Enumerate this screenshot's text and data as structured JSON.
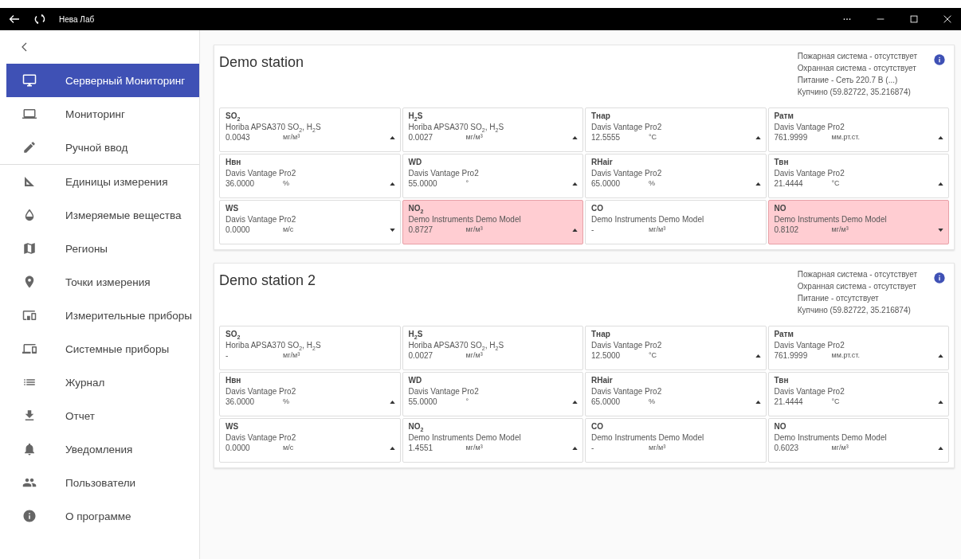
{
  "window": {
    "title": "Нева Лаб"
  },
  "sidebar": {
    "sections": [
      [
        {
          "label": "Серверный Мониторинг",
          "selected": true
        },
        {
          "label": "Мониторинг",
          "selected": false
        },
        {
          "label": "Ручной ввод",
          "selected": false
        }
      ],
      [
        {
          "label": "Единицы измерения",
          "selected": false
        },
        {
          "label": "Измеряемые вещества",
          "selected": false
        },
        {
          "label": "Регионы",
          "selected": false
        },
        {
          "label": "Точки измерения",
          "selected": false
        },
        {
          "label": "Измерительные приборы",
          "selected": false
        },
        {
          "label": "Системные приборы",
          "selected": false
        },
        {
          "label": "Журнал",
          "selected": false
        },
        {
          "label": "Отчет",
          "selected": false
        },
        {
          "label": "Уведомления",
          "selected": false
        },
        {
          "label": "Пользователи",
          "selected": false
        },
        {
          "label": "О программе",
          "selected": false
        }
      ]
    ]
  },
  "stations": [
    {
      "name": "Demo station",
      "info": [
        "Пожарная система - отсутствует",
        "Охранная система - отсутствует",
        "Питание - Сеть 220.7 В (...)",
        "Купчино (59.82722, 35.216874)"
      ],
      "sensors": [
        {
          "kind": "rising",
          "name": "SO$_{2}$",
          "device": "Horiba APSA370 SO$_{2}$, H$_{2}$S",
          "value": "0.0043",
          "unit": "мг/м³",
          "alarm": false
        },
        {
          "kind": "rising",
          "name": "H$_{2}$S",
          "device": "Horiba APSA370 SO$_{2}$, H$_{2}$S",
          "value": "0.0027",
          "unit": "мг/м³",
          "alarm": false
        },
        {
          "kind": "rising",
          "name": "Тнар",
          "device": "Davis Vantage Pro2",
          "value": "12.5555",
          "unit": "°C",
          "alarm": false
        },
        {
          "kind": "rising",
          "name": "Ратм",
          "device": "Davis Vantage Pro2",
          "value": "761.9999",
          "unit": "мм.рт.ст.",
          "alarm": false
        },
        {
          "kind": "rising",
          "name": "Нвн",
          "device": "Davis Vantage Pro2",
          "value": "36.0000",
          "unit": "%",
          "alarm": false
        },
        {
          "kind": "rising",
          "name": "WD",
          "device": "Davis Vantage Pro2",
          "value": "55.0000",
          "unit": "°",
          "alarm": false
        },
        {
          "kind": "rising",
          "name": "RHair",
          "device": "Davis Vantage Pro2",
          "value": "65.0000",
          "unit": "%",
          "alarm": false
        },
        {
          "kind": "rising",
          "name": "Твн",
          "device": "Davis Vantage Pro2",
          "value": "21.4444",
          "unit": "°C",
          "alarm": false
        },
        {
          "kind": "falling",
          "name": "WS",
          "device": "Davis Vantage Pro2",
          "value": "0.0000",
          "unit": "м/с",
          "alarm": false
        },
        {
          "kind": "rising",
          "name": "NO$_{2}$",
          "device": "Demo Instruments Demo Model",
          "value": "0.8727",
          "unit": "мг/м³",
          "alarm": true
        },
        {
          "kind": "plain",
          "name": "CO",
          "device": "Demo Instruments Demo Model",
          "value": "-",
          "unit": "мг/м³",
          "alarm": false
        },
        {
          "kind": "falling",
          "name": "NO",
          "device": "Demo Instruments Demo Model",
          "value": "0.8102",
          "unit": "мг/м³",
          "alarm": true
        }
      ]
    },
    {
      "name": "Demo station 2",
      "info": [
        "Пожарная система - отсутствует",
        "Охранная система - отсутствует",
        "Питание - отсутствует",
        "Купчино (59.82722, 35.216874)"
      ],
      "sensors": [
        {
          "kind": "plain",
          "name": "SO$_{2}$",
          "device": "Horiba APSA370 SO$_{2}$, H$_{2}$S",
          "value": "-",
          "unit": "мг/м³",
          "alarm": false
        },
        {
          "kind": "plain",
          "name": "H$_{2}$S",
          "device": "Horiba APSA370 SO$_{2}$, H$_{2}$S",
          "value": "0.0027",
          "unit": "мг/м³",
          "alarm": false
        },
        {
          "kind": "rising",
          "name": "Тнар",
          "device": "Davis Vantage Pro2",
          "value": "12.5000",
          "unit": "°C",
          "alarm": false
        },
        {
          "kind": "rising",
          "name": "Ратм",
          "device": "Davis Vantage Pro2",
          "value": "761.9999",
          "unit": "мм.рт.ст.",
          "alarm": false
        },
        {
          "kind": "rising",
          "name": "Нвн",
          "device": "Davis Vantage Pro2",
          "value": "36.0000",
          "unit": "%",
          "alarm": false
        },
        {
          "kind": "rising",
          "name": "WD",
          "device": "Davis Vantage Pro2",
          "value": "55.0000",
          "unit": "°",
          "alarm": false
        },
        {
          "kind": "rising",
          "name": "RHair",
          "device": "Davis Vantage Pro2",
          "value": "65.0000",
          "unit": "%",
          "alarm": false
        },
        {
          "kind": "rising",
          "name": "Твн",
          "device": "Davis Vantage Pro2",
          "value": "21.4444",
          "unit": "°C",
          "alarm": false
        },
        {
          "kind": "rising",
          "name": "WS",
          "device": "Davis Vantage Pro2",
          "value": "0.0000",
          "unit": "м/с",
          "alarm": false
        },
        {
          "kind": "rising",
          "name": "NO$_{2}$",
          "device": "Demo Instruments Demo Model",
          "value": "1.4551",
          "unit": "мг/м³",
          "alarm": false
        },
        {
          "kind": "plain",
          "name": "CO",
          "device": "Demo Instruments Demo Model",
          "value": "-",
          "unit": "мг/м³",
          "alarm": false
        },
        {
          "kind": "rising",
          "name": "NO",
          "device": "Demo Instruments Demo Model",
          "value": "0.6023",
          "unit": "мг/м³",
          "alarm": false
        }
      ]
    }
  ]
}
